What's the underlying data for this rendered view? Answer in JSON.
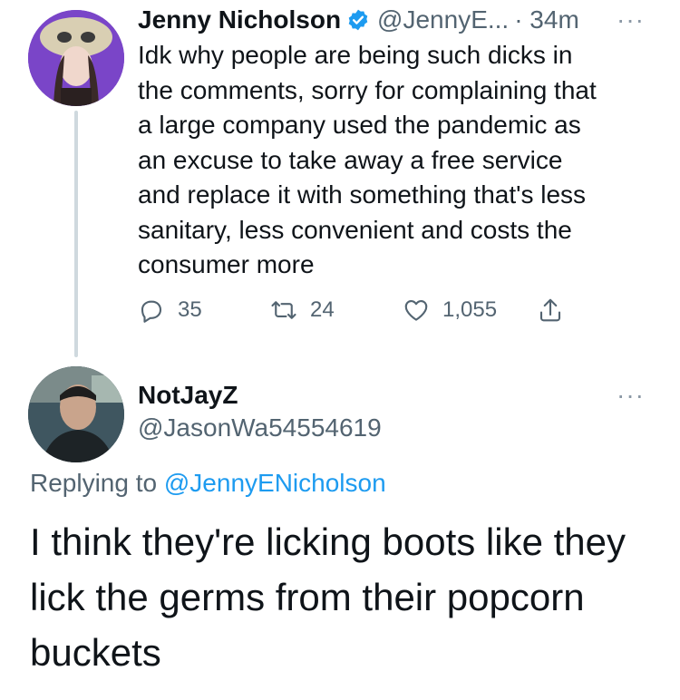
{
  "tweet1": {
    "display_name": "Jenny Nicholson",
    "handle": "@JennyE...",
    "time": "· 34m",
    "more_label": "···",
    "text": "Idk why people are being such dicks in\nthe comments, sorry for complaining that\na large company used the pandemic as\nan excuse to take away a free service\nand replace it with something that's less\nsanitary, less convenient and costs the\nconsumer more",
    "actions": {
      "replies": "35",
      "retweets": "24",
      "likes": "1,055"
    },
    "icons": [
      "verified-badge-icon",
      "reply-icon",
      "retweet-icon",
      "like-icon",
      "share-icon"
    ]
  },
  "tweet2": {
    "display_name": "NotJayZ",
    "handle": "@JasonWa54554619",
    "more_label": "···",
    "replying_prefix": "Replying to ",
    "replying_handle": "@JennyENicholson",
    "text": "I think they're licking boots like they\nlick the germs from their popcorn\nbuckets"
  },
  "colors": {
    "accent": "#1d9bf0",
    "secondary_text": "#536471",
    "primary_text": "#0f1419",
    "thread_line": "#cfd9de"
  }
}
